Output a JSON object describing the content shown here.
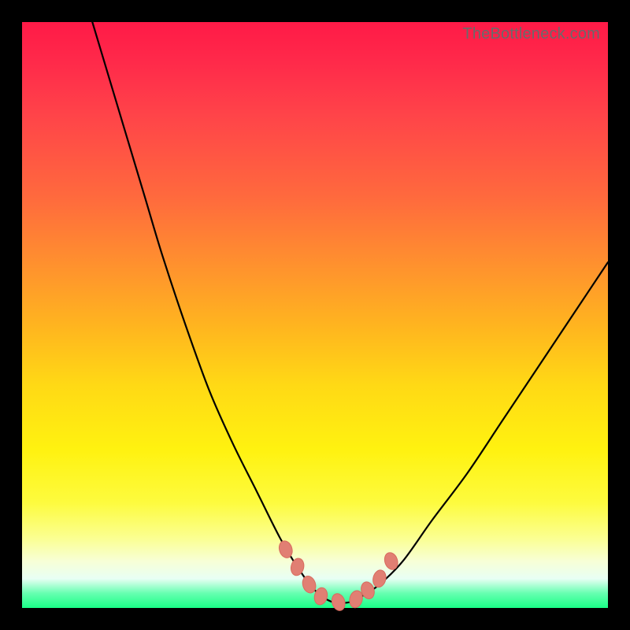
{
  "watermark": "TheBottleneck.com",
  "colors": {
    "background": "#000000",
    "gradient_stops": [
      {
        "pct": 0,
        "hex": "#ff1a47"
      },
      {
        "pct": 7,
        "hex": "#ff2a4a"
      },
      {
        "pct": 16,
        "hex": "#ff4449"
      },
      {
        "pct": 30,
        "hex": "#ff6a3d"
      },
      {
        "pct": 40,
        "hex": "#ff8c30"
      },
      {
        "pct": 52,
        "hex": "#ffb51f"
      },
      {
        "pct": 62,
        "hex": "#ffd915"
      },
      {
        "pct": 73,
        "hex": "#fff210"
      },
      {
        "pct": 82,
        "hex": "#fdfb3e"
      },
      {
        "pct": 88,
        "hex": "#fbff90"
      },
      {
        "pct": 92,
        "hex": "#f7ffd6"
      },
      {
        "pct": 95,
        "hex": "#e8fff4"
      },
      {
        "pct": 97.5,
        "hex": "#66ffb0"
      },
      {
        "pct": 100,
        "hex": "#1aff87"
      }
    ],
    "marker_fill": "#e17f73",
    "marker_stroke": "#d86b5e",
    "curve_stroke": "#000000"
  },
  "chart_data": {
    "type": "line",
    "title": "",
    "xlabel": "",
    "ylabel": "",
    "xlim": [
      0,
      100
    ],
    "ylim": [
      0,
      100
    ],
    "legend": false,
    "grid": false,
    "description": "Asymmetric V-shaped bottleneck curve; y decreases steeply from left, flattens at valley ~x 50–58, then rises more gently to right. Valley bottom near y≈1.",
    "series": [
      {
        "name": "bottleneck-curve",
        "x": [
          12,
          15,
          18,
          21,
          24,
          28,
          32,
          36,
          40,
          44,
          47,
          50,
          53,
          56,
          58,
          61,
          65,
          70,
          76,
          82,
          88,
          94,
          100
        ],
        "y": [
          100,
          90,
          80,
          70,
          60,
          48,
          37,
          28,
          20,
          12,
          7,
          3,
          1,
          1,
          2,
          4,
          8,
          15,
          23,
          32,
          41,
          50,
          59
        ]
      }
    ],
    "markers": {
      "name": "valley-markers",
      "shape": "ellipse",
      "points_xy": [
        [
          45,
          10
        ],
        [
          47,
          7
        ],
        [
          49,
          4
        ],
        [
          51,
          2
        ],
        [
          54,
          1
        ],
        [
          57,
          1.5
        ],
        [
          59,
          3
        ],
        [
          61,
          5
        ],
        [
          63,
          8
        ]
      ]
    }
  }
}
